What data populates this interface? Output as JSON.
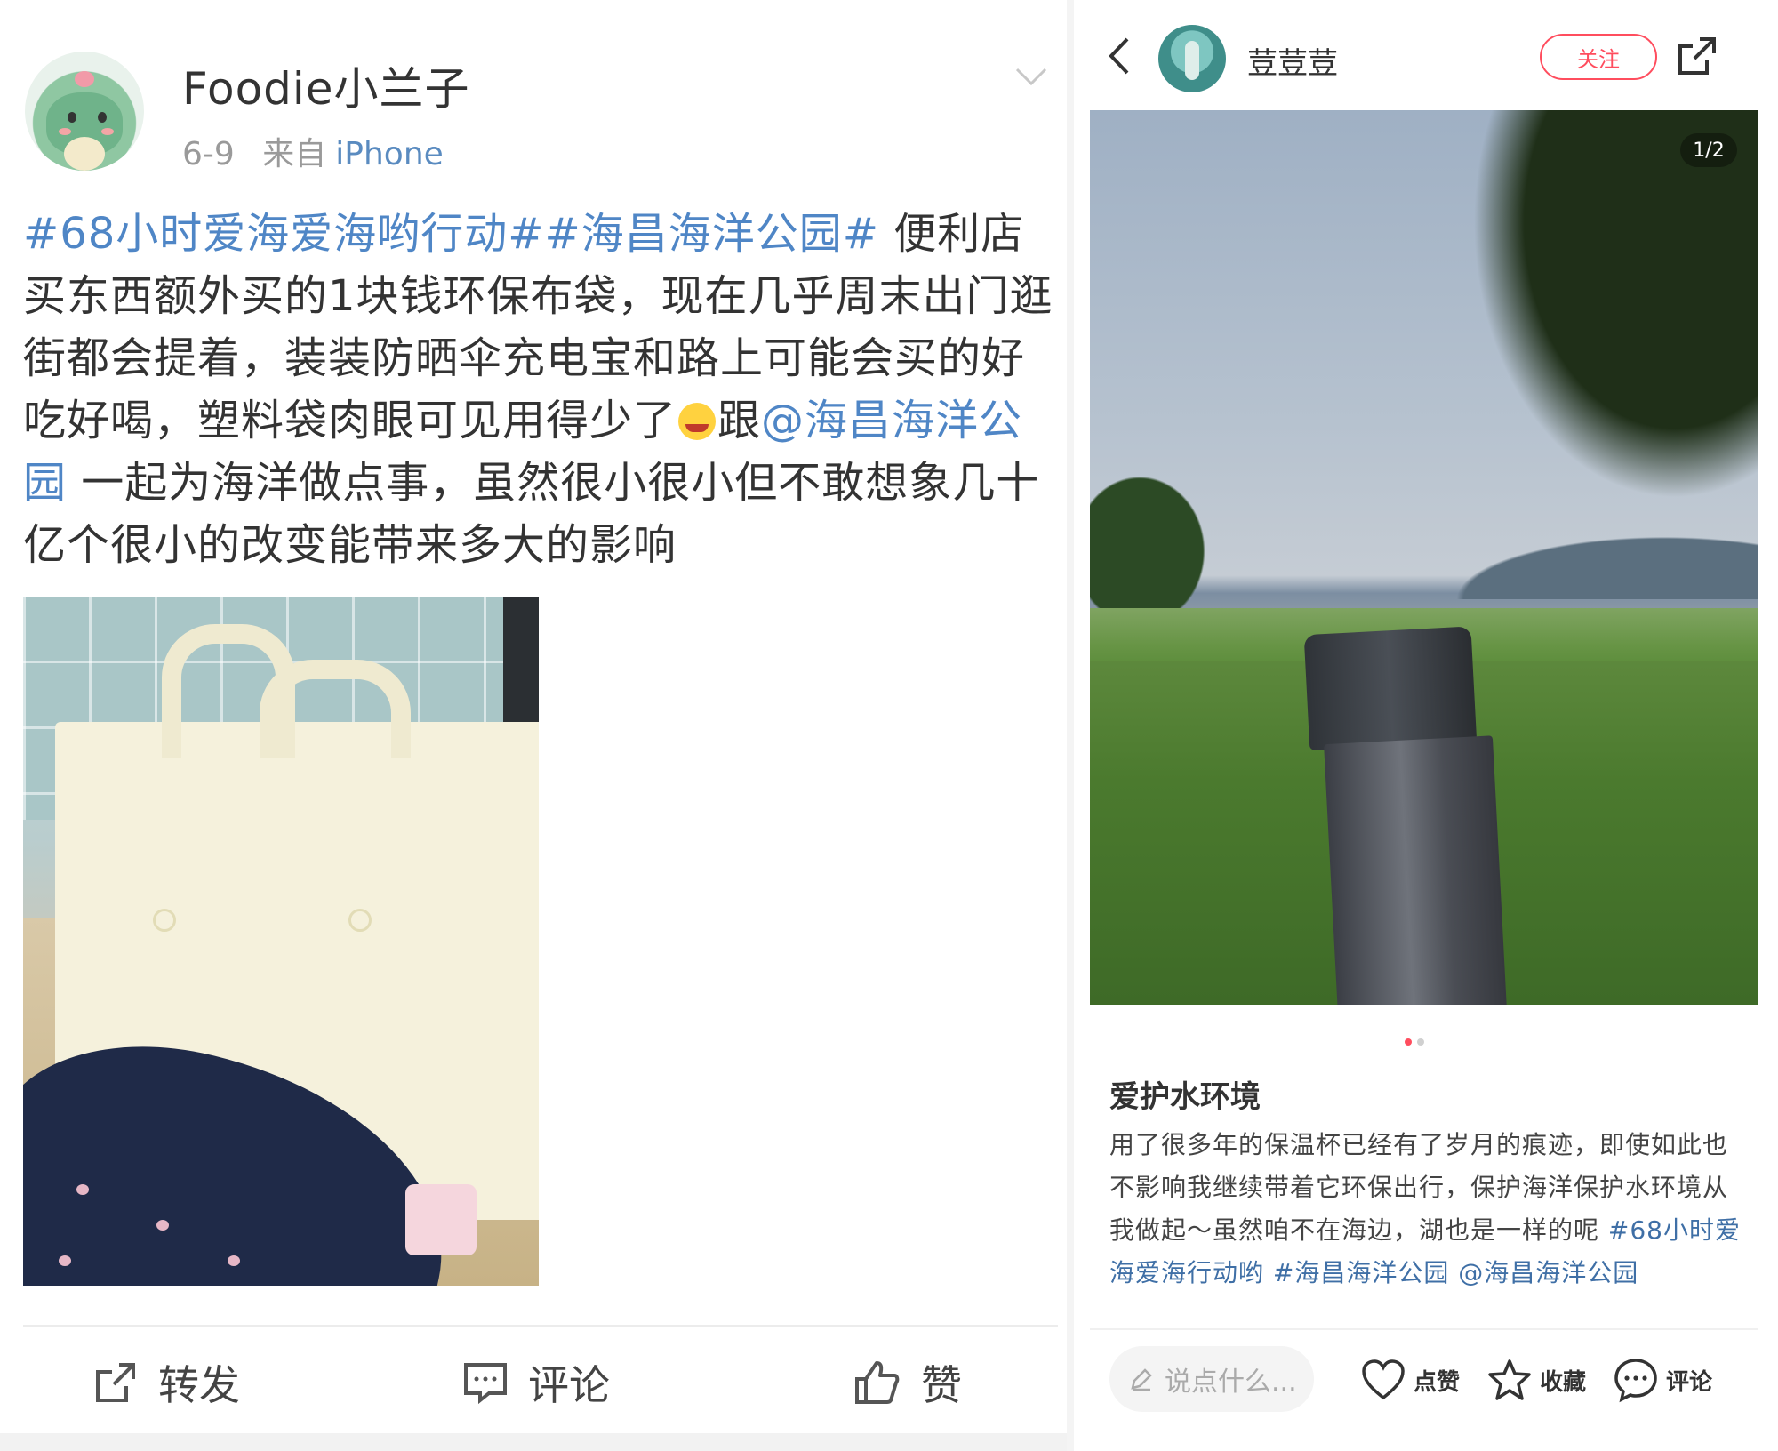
{
  "left_post": {
    "username": "Foodie小兰子",
    "date": "6-9",
    "source_prefix": "来自",
    "source": "iPhone",
    "hashtag1": "#68小时爱海爱海哟行动#",
    "hashtag2": "#海昌海洋公园#",
    "text1": " 便利店买东西额外买的1块钱环保布袋，现在几乎周末出门逛街都会提着，装装防晒伞充电宝和路上可能会买的好吃好喝，塑料袋肉眼可见用得少了",
    "text2": "跟",
    "mention": "@海昌海洋公园",
    "text3": " 一起为海洋做点事，虽然很小很小但不敢想象几十亿个很小的改变能带来多大的影响",
    "actions": {
      "repost": "转发",
      "comment": "评论",
      "like": "赞"
    }
  },
  "right_post": {
    "username": "荳荳荳",
    "follow_label": "关注",
    "page_counter": "1/2",
    "title": "爱护水环境",
    "body": "用了很多年的保温杯已经有了岁月的痕迹，即使如此也不影响我继续带着它环保出行，保护海洋保护水环境从我做起～虽然咱不在海边，湖也是一样的呢 ",
    "tag1": "#68小时爱海爱海行动哟",
    "tag2": "#海昌海洋公园",
    "mention": "@海昌海洋公园",
    "comment_placeholder": "说点什么...",
    "actions": {
      "like": "点赞",
      "collect": "收藏",
      "comment": "评论"
    }
  },
  "colors": {
    "link_blue": "#4f86c6",
    "xhs_red": "#ff4d5e"
  }
}
